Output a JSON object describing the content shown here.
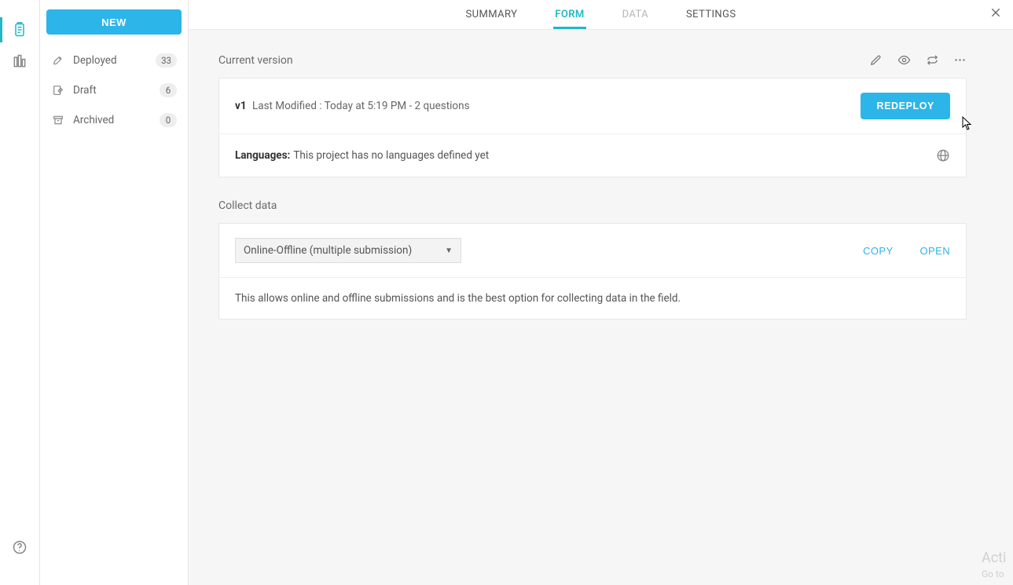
{
  "sidebar": {
    "new_button": "NEW",
    "items": [
      {
        "label": "Deployed",
        "count": "33"
      },
      {
        "label": "Draft",
        "count": "6"
      },
      {
        "label": "Archived",
        "count": "0"
      }
    ]
  },
  "tabs": {
    "summary": "SUMMARY",
    "form": "FORM",
    "data": "DATA",
    "settings": "SETTINGS"
  },
  "current_version": {
    "title": "Current version",
    "version_label": "v1",
    "meta": "Last Modified : Today at 5:19 PM - 2 questions",
    "redeploy": "REDEPLOY",
    "languages_label": "Languages:",
    "languages_text": "This project has no languages defined yet"
  },
  "collect": {
    "title": "Collect data",
    "select_value": "Online-Offline (multiple submission)",
    "copy": "COPY",
    "open": "OPEN",
    "description": "This allows online and offline submissions and is the best option for collecting data in the field."
  },
  "watermark": {
    "line1": "Acti",
    "line2": "Go to"
  }
}
